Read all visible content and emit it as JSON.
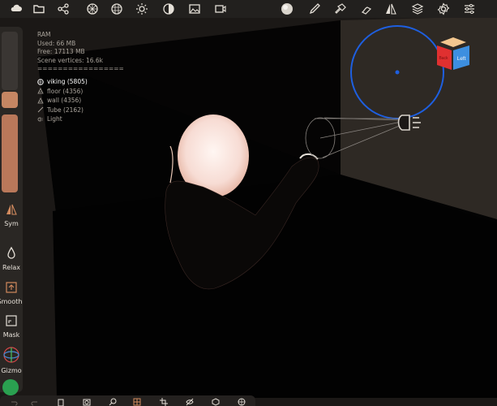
{
  "toolbar": {
    "icons": [
      "cloud-icon",
      "folder-icon",
      "share-icon",
      "scene-icon",
      "topology-icon",
      "light-icon",
      "shading-icon",
      "image-icon",
      "video-icon",
      "material-sphere-icon",
      "brush-icon",
      "pin-icon",
      "paint-icon",
      "symmetry-icon",
      "layers-icon",
      "settings-icon",
      "sliders-icon"
    ]
  },
  "stats": {
    "ram": "RAM",
    "used": "Used: 66 MB",
    "free": "Free: 17113 MB",
    "vertices": "Scene vertices: 16.6k",
    "separator": "================="
  },
  "objects": [
    {
      "label": "viking (5805)",
      "icon": "mesh-icon",
      "selected": true
    },
    {
      "label": "floor (4356)",
      "icon": "mesh-icon",
      "selected": false
    },
    {
      "label": "wall (4356)",
      "icon": "mesh-icon",
      "selected": false
    },
    {
      "label": "Tube (2162)",
      "icon": "tube-icon",
      "selected": false
    },
    {
      "label": "Light",
      "icon": "light-icon",
      "selected": false
    }
  ],
  "left_panel": {
    "sym": "Sym",
    "relax": "Relax",
    "smooth": "Smooth",
    "mask": "Mask",
    "gizmo": "Gizmo",
    "radius_color": "#c58663",
    "intensity_color": "#b9785a"
  },
  "view_cube": {
    "left_face": "Left",
    "side_face": "Back",
    "left_color": "#3d8fe0",
    "side_color": "#e03030",
    "top_color": "#f3c78f"
  },
  "bottom_toolbar": {
    "icons": [
      "undo-icon",
      "redo-icon",
      "clipboard-icon",
      "camera-icon",
      "search-icon",
      "grid-icon",
      "crop-icon",
      "hide-icon",
      "mesh-icon",
      "wireframe-icon"
    ]
  },
  "colors": {
    "light_gizmo": "#1e5fe0",
    "background": "#1b1816"
  }
}
